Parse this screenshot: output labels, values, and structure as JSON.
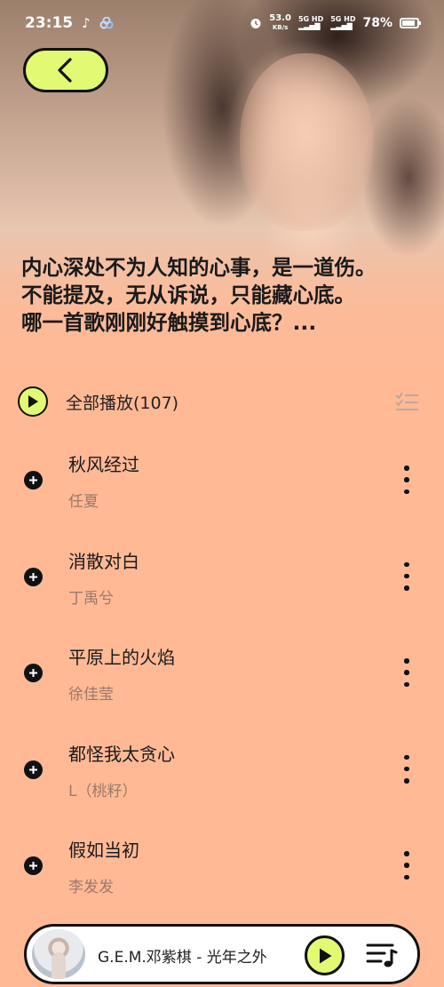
{
  "status_bar": {
    "time": "23:15",
    "net_speed_value": "53.0",
    "net_speed_unit": "KB/s",
    "signal_1": "5G HD",
    "signal_2": "5G HD",
    "battery": "78%",
    "battery_level": 0.78
  },
  "header": {
    "back_icon": "chevron-left-icon"
  },
  "description": "内心深处不为人知的心事，是一道伤。\n不能提及，无从诉说，只能藏心底。\n哪一首歌刚刚好触摸到心底？...",
  "play_all": {
    "label": "全部播放(107)"
  },
  "songs": [
    {
      "title": "秋风经过",
      "artist": "任夏"
    },
    {
      "title": "消散对白",
      "artist": "丁禹兮"
    },
    {
      "title": "平原上的火焰",
      "artist": "徐佳莹"
    },
    {
      "title": "都怪我太贪心",
      "artist": "L（桃籽）"
    },
    {
      "title": "假如当初",
      "artist": "李发发"
    }
  ],
  "mini_player": {
    "now_playing": "G.E.M.邓紫棋 - 光年之外"
  },
  "colors": {
    "background": "#ffb995",
    "accent": "#e2f974",
    "artist_text": "#9a7a6c"
  }
}
